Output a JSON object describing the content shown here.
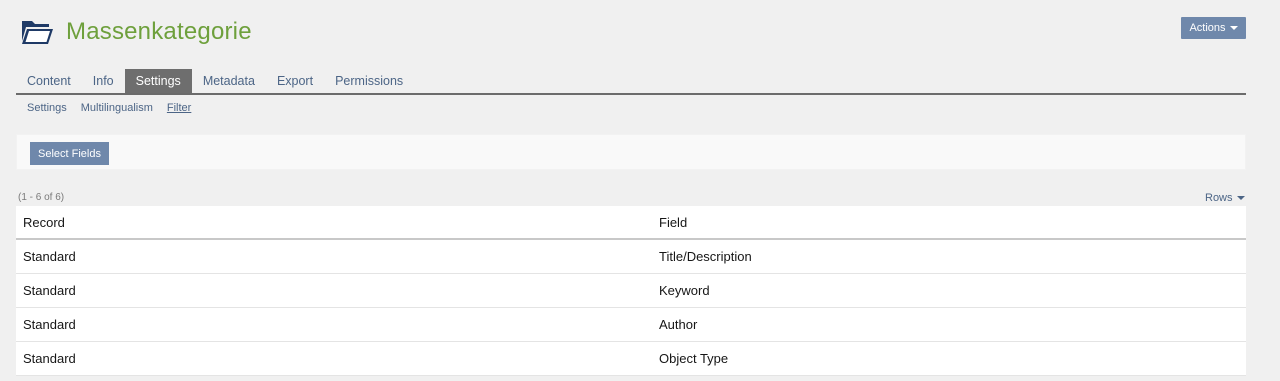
{
  "header": {
    "icon": "folder-open-icon",
    "title": "Massenkategorie",
    "actions_label": "Actions"
  },
  "tabs": [
    {
      "label": "Content"
    },
    {
      "label": "Info"
    },
    {
      "label": "Settings",
      "active": true
    },
    {
      "label": "Metadata"
    },
    {
      "label": "Export"
    },
    {
      "label": "Permissions"
    }
  ],
  "subtabs": [
    {
      "label": "Settings"
    },
    {
      "label": "Multilingualism"
    },
    {
      "label": "Filter",
      "active": true
    }
  ],
  "toolbar": {
    "select_fields_label": "Select Fields"
  },
  "table": {
    "range_info": "(1 - 6 of 6)",
    "rows_label": "Rows",
    "columns": [
      "Record",
      "Field"
    ],
    "rows": [
      [
        "Standard",
        "Title/Description"
      ],
      [
        "Standard",
        "Keyword"
      ],
      [
        "Standard",
        "Author"
      ],
      [
        "Standard",
        "Object Type"
      ]
    ]
  },
  "colors": {
    "title": "#6ea03c",
    "button": "#6f88ab",
    "active_tab": "#6e6e6e",
    "link": "#4c6586"
  }
}
